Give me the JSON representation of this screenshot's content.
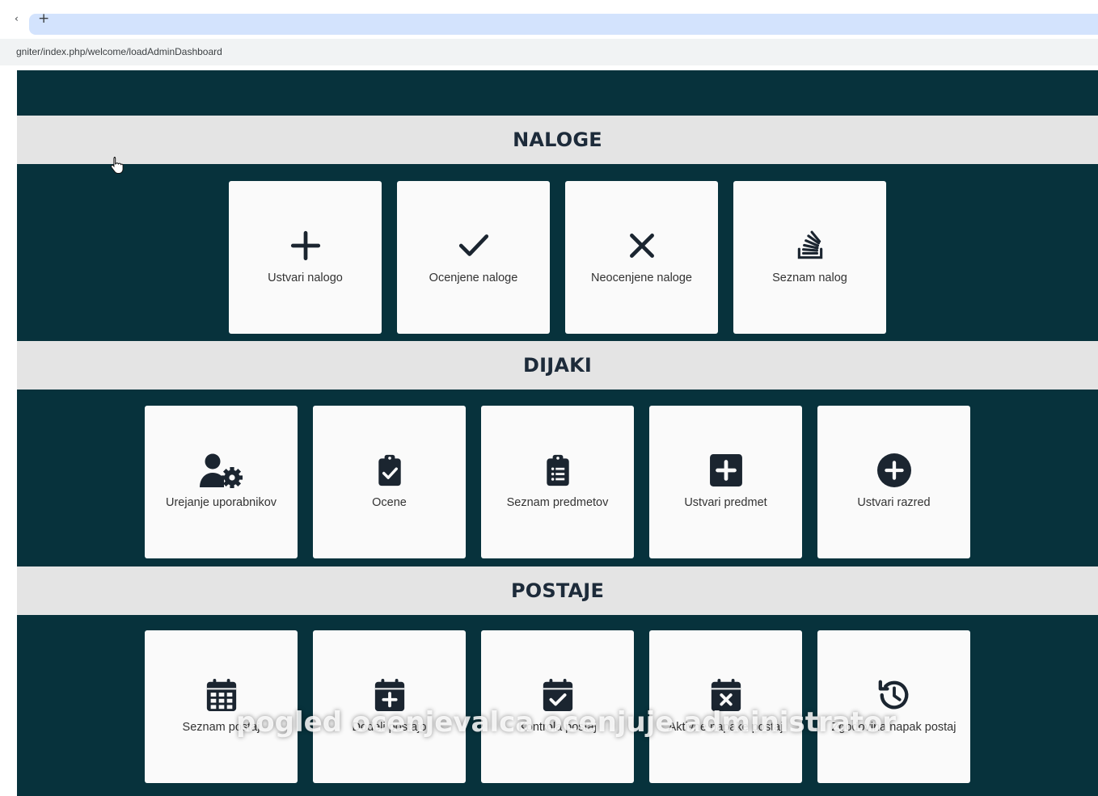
{
  "browser": {
    "back_glyph": "‹",
    "new_tab_glyph": "+",
    "url": "gniter/index.php/welcome/loadAdminDashboard"
  },
  "colors": {
    "navy": "#07323c",
    "band": "#e4e4e4",
    "card": "#fafafa",
    "icon": "#1b2530"
  },
  "sections": {
    "naloge": {
      "title": "NALOGE",
      "cards": [
        {
          "label": "Ustvari nalogo",
          "icon": "plus-icon"
        },
        {
          "label": "Ocenjene naloge",
          "icon": "check-icon"
        },
        {
          "label": "Neocenjene naloge",
          "icon": "x-icon"
        },
        {
          "label": "Seznam nalog",
          "icon": "stack-icon"
        }
      ]
    },
    "dijaki": {
      "title": "DIJAKI",
      "cards": [
        {
          "label": "Urejanje uporabnikov",
          "icon": "user-gear-icon"
        },
        {
          "label": "Ocene",
          "icon": "clipboard-check-icon"
        },
        {
          "label": "Seznam predmetov",
          "icon": "clipboard-list-icon"
        },
        {
          "label": "Ustvari predmet",
          "icon": "square-plus-icon"
        },
        {
          "label": "Ustvari razred",
          "icon": "circle-plus-icon"
        }
      ]
    },
    "postaje": {
      "title": "POSTAJE",
      "cards": [
        {
          "label": "Seznam postaj",
          "icon": "calendar-grid-icon"
        },
        {
          "label": "Dodeli postajo",
          "icon": "calendar-plus-icon"
        },
        {
          "label": "Kontrola postaj",
          "icon": "calendar-check-icon"
        },
        {
          "label": "Aktivne napake postaj",
          "icon": "calendar-x-icon"
        },
        {
          "label": "Zgodovina napak postaj",
          "icon": "history-icon"
        }
      ]
    }
  },
  "overlay_caption": "pogled ocenjevalca ocenjuje administrator"
}
